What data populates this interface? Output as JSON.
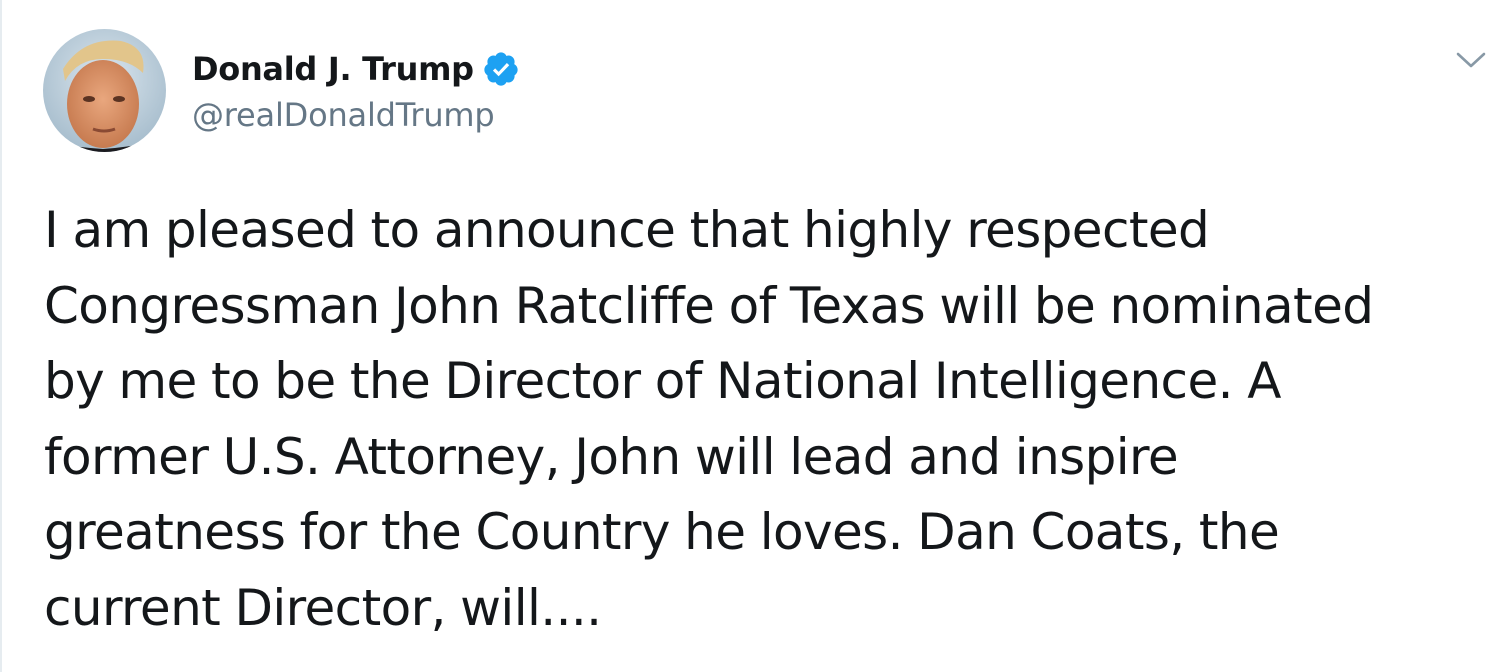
{
  "user": {
    "display_name": "Donald J. Trump",
    "handle": "@realDonaldTrump",
    "verified": true
  },
  "tweet": {
    "text_lines": [
      "I am pleased to announce that highly respected",
      "Congressman John Ratcliffe of Texas will be nominated",
      "by me to be the Director of National Intelligence. A",
      "former U.S. Attorney, John will lead and inspire",
      "greatness for the Country he loves. Dan Coats, the",
      "current Director, will...."
    ]
  },
  "icons": {
    "verified": "verified-badge-icon",
    "menu": "chevron-down-icon"
  },
  "colors": {
    "text": "#14171a",
    "secondary": "#657786",
    "verified_blue": "#1da1f2",
    "border": "#e6ecf0"
  }
}
